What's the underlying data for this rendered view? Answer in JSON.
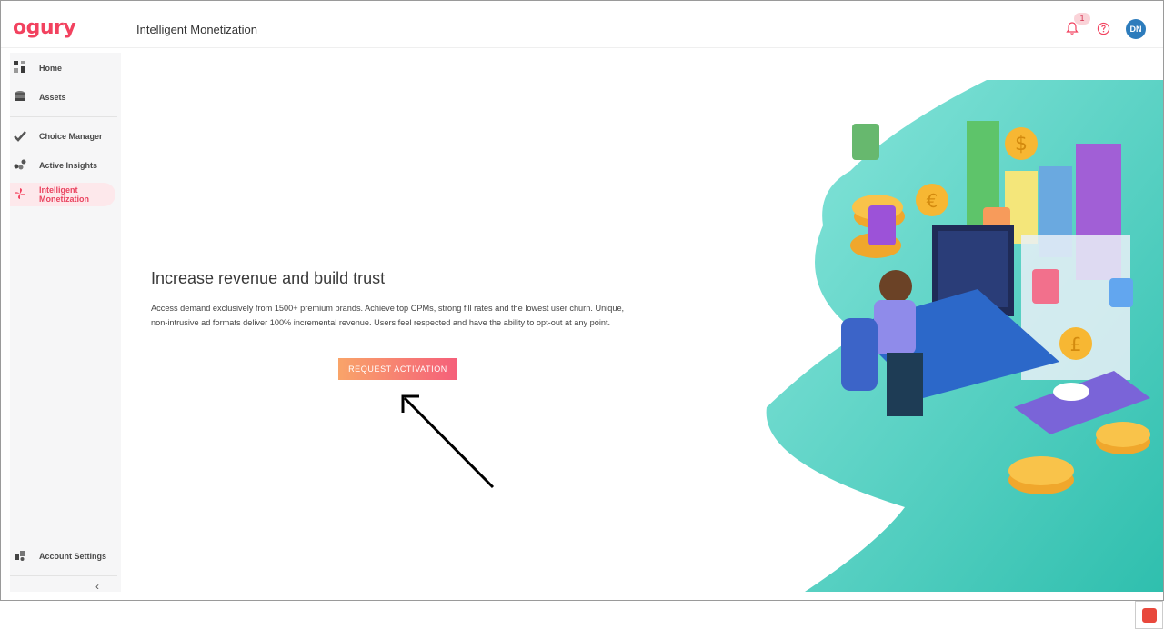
{
  "header": {
    "logo_text": "ogury",
    "title": "Intelligent Monetization",
    "notification_count": "1",
    "avatar_initials": "DN",
    "icons": [
      "bell-icon",
      "help-icon"
    ]
  },
  "sidebar": {
    "items": [
      {
        "label": "Home",
        "icon": "grid-icon"
      },
      {
        "label": "Assets",
        "icon": "stack-icon"
      },
      {
        "label": "Choice Manager",
        "icon": "checkmark-icon"
      },
      {
        "label": "Active Insights",
        "icon": "insights-icon"
      },
      {
        "label": "Intelligent Monetization",
        "icon": "pinwheel-icon",
        "active": true
      },
      {
        "label": "Account Settings",
        "icon": "settings-icon"
      }
    ],
    "collapse_glyph": "‹"
  },
  "main": {
    "headline": "Increase revenue and build trust",
    "description": "Access demand exclusively from 1500+ premium brands. Achieve top CPMs, strong fill rates and the lowest user churn. Unique, non-intrusive ad formats deliver 100% incremental revenue. Users feel respected and have the ability to opt-out at any point.",
    "cta_label": "REQUEST ACTIVATION"
  },
  "colors": {
    "brand": "#f2425f",
    "cta_start": "#f9a469",
    "cta_end": "#f55f7a",
    "avatar": "#2d7cbc",
    "illustration_bg": "#4fd1c5"
  }
}
